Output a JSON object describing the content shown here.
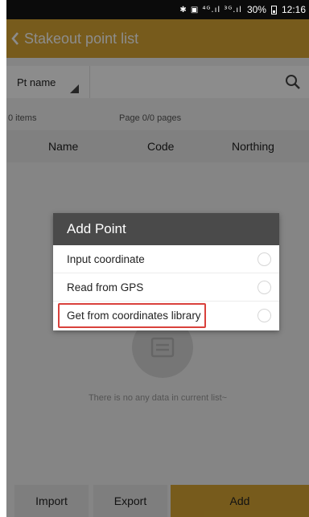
{
  "status_bar": {
    "indicators": "✱ ▣ ⁴ᴳ.ıl ³ᴳ.ıl",
    "battery": "30%",
    "time": "12:16"
  },
  "header": {
    "title": "Stakeout point list"
  },
  "search": {
    "field_label": "Pt name",
    "value": "",
    "placeholder": ""
  },
  "info": {
    "count": "0 items",
    "page": "Page 0/0 pages"
  },
  "table": {
    "columns": [
      "Name",
      "Code",
      "Northing"
    ]
  },
  "empty_state": {
    "message": "There is no any data in current list~"
  },
  "footer": {
    "import_label": "Import",
    "export_label": "Export",
    "add_label": "Add"
  },
  "dialog": {
    "title": "Add Point",
    "options": [
      {
        "label": "Input coordinate"
      },
      {
        "label": "Read from GPS"
      },
      {
        "label": "Get from coordinates library",
        "highlighted": true
      }
    ]
  },
  "colors": {
    "accent": "#d9a733",
    "highlight": "#d9413c",
    "dialog_title_bg": "#4a4a4a"
  }
}
